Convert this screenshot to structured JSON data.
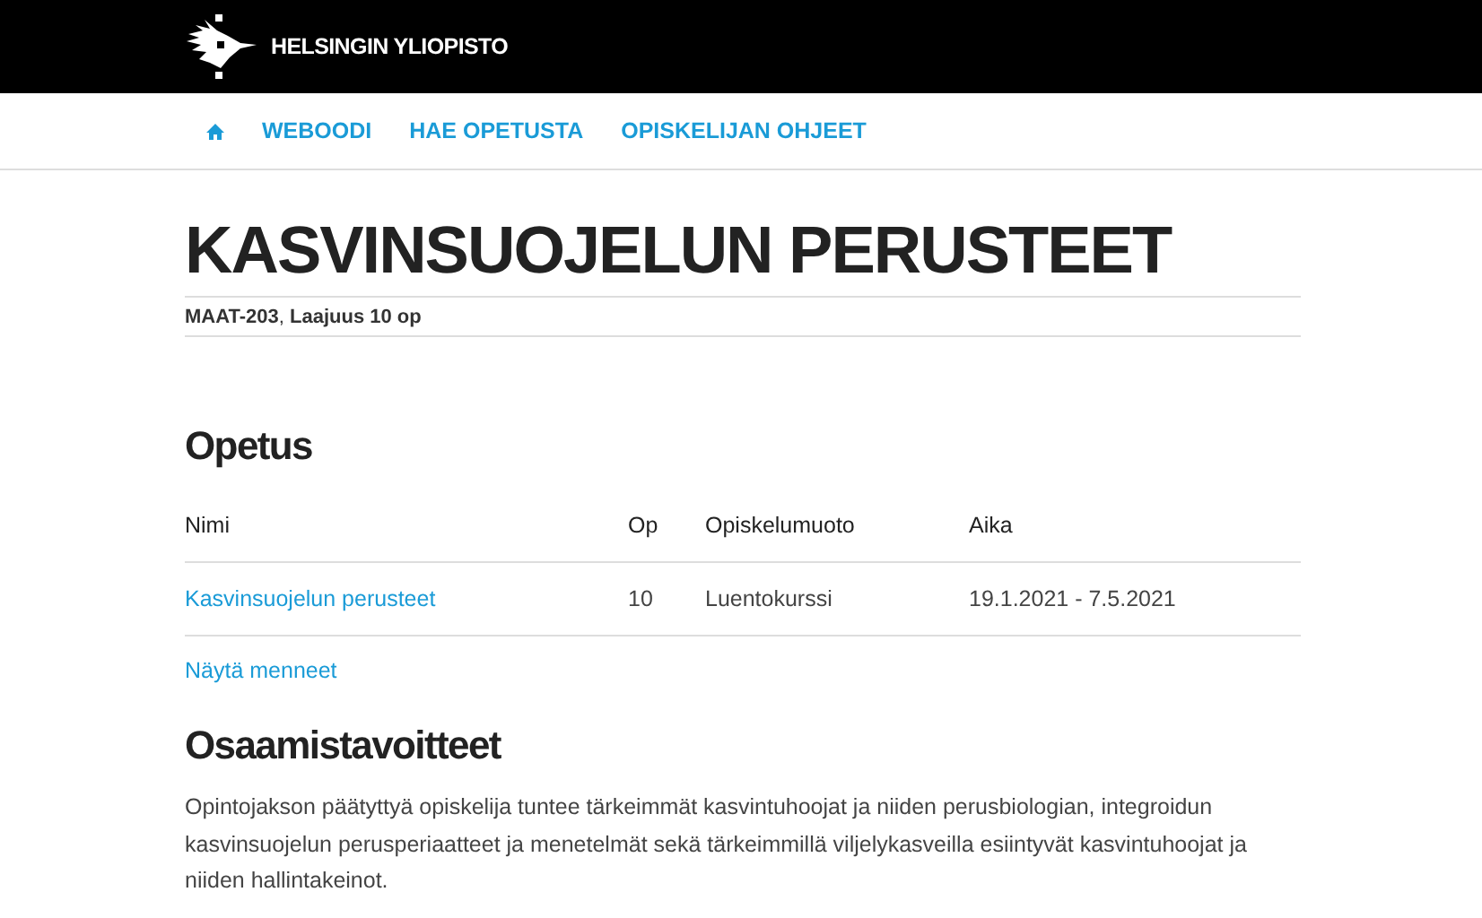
{
  "header": {
    "logo_text": "HELSINGIN YLIOPISTO"
  },
  "nav": {
    "items": [
      {
        "label": "WEBOODI"
      },
      {
        "label": "HAE OPETUSTA"
      },
      {
        "label": "OPISKELIJAN OHJEET"
      }
    ]
  },
  "course": {
    "title": "KASVINSUOJELUN PERUSTEET",
    "meta": "**MAAT-203**, **Laajuus 10 op**"
  },
  "teaching": {
    "heading": "Opetus",
    "table": {
      "columns": [
        "Nimi",
        "Op",
        "Opiskelumuoto",
        "Aika"
      ],
      "rows": [
        {
          "cells": [
            "Kasvinsuojelun perusteet",
            "10",
            "Luentokurssi",
            "19.1.2021 - 7.5.2021"
          ]
        }
      ]
    },
    "show_past_link": "Näytä menneet"
  },
  "outcomes": {
    "heading": "Osaamistavoitteet",
    "text": "Opintojakson päätyttyä opiskelija tuntee tärkeimmät kasvintuhoojat ja niiden perusbiologian, integroidun kasvinsuojelun perusperiaatteet ja menetelmät sekä tärkeimmillä viljelykasveilla esiintyvät kasvintuhoojat ja niiden hallintakeinot."
  }
}
